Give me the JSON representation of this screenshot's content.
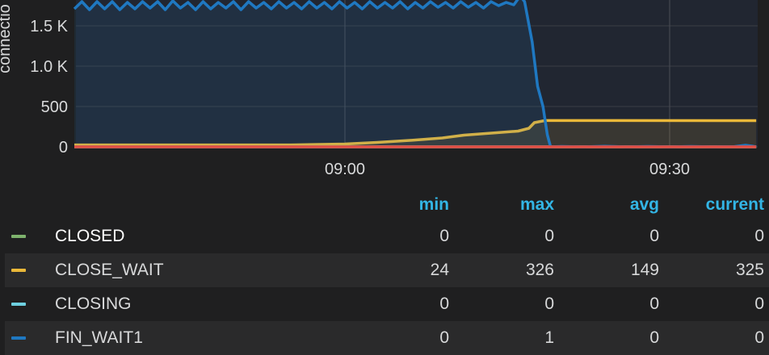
{
  "chart_data": {
    "type": "line",
    "ylabel": "connectio",
    "x_ticks": [
      "09:00",
      "09:30"
    ],
    "y_ticks": [
      "0",
      "500",
      "1.0 K",
      "1.5 K"
    ],
    "y_tick_values": [
      0,
      500,
      1000,
      1500
    ],
    "ylim": [
      0,
      1870
    ],
    "x_range_minutes": [
      -25,
      38
    ],
    "grid": true,
    "series": [
      {
        "name": "CLOSED",
        "color": "#7eb26d",
        "x": [
          -25,
          38
        ],
        "y": [
          0,
          0
        ],
        "fill": false
      },
      {
        "name": "CLOSE_WAIT",
        "color": "#eab839",
        "x": [
          -25,
          -5,
          0,
          3,
          6,
          9,
          11,
          14,
          16,
          17,
          17.5,
          18.5,
          38
        ],
        "y": [
          24,
          24,
          35,
          55,
          80,
          110,
          145,
          175,
          195,
          230,
          300,
          326,
          325
        ],
        "fill": true
      },
      {
        "name": "CLOSING",
        "color": "#6ed0e0",
        "x": [
          -25,
          38
        ],
        "y": [
          0,
          0
        ],
        "fill": false
      },
      {
        "name": "FIN_WAIT1",
        "color": "#1f78c1",
        "x": [
          -25,
          -24.3,
          -23.6,
          -22.9,
          -22.2,
          -21.5,
          -20.8,
          -20.1,
          -19.4,
          -18.7,
          -18,
          -17.3,
          -16.6,
          -15.9,
          -15.2,
          -14.5,
          -13.8,
          -13.1,
          -12.4,
          -11.7,
          -11,
          -10.3,
          -9.6,
          -8.9,
          -8.2,
          -7.5,
          -6.8,
          -6.1,
          -5.4,
          -4.7,
          -4,
          -3.3,
          -2.6,
          -1.9,
          -1.2,
          -0.5,
          0.2,
          0.9,
          1.6,
          2.3,
          3,
          3.7,
          4.4,
          5.1,
          5.8,
          6.5,
          7.2,
          7.9,
          8.6,
          9.3,
          10,
          10.7,
          11.4,
          12.1,
          12.8,
          13.5,
          14.2,
          14.9,
          15.6,
          16.2,
          16.6,
          17.3,
          17.8,
          18.3,
          18.7,
          19,
          20,
          22,
          24,
          26,
          28,
          30,
          32,
          34,
          36,
          37,
          37.6,
          38
        ],
        "y": [
          1710,
          1800,
          1700,
          1800,
          1710,
          1800,
          1700,
          1790,
          1710,
          1800,
          1720,
          1800,
          1700,
          1810,
          1720,
          1790,
          1700,
          1800,
          1710,
          1790,
          1720,
          1800,
          1700,
          1800,
          1720,
          1790,
          1710,
          1800,
          1720,
          1790,
          1710,
          1800,
          1720,
          1790,
          1710,
          1800,
          1720,
          1790,
          1710,
          1800,
          1720,
          1790,
          1720,
          1800,
          1710,
          1790,
          1720,
          1800,
          1730,
          1790,
          1720,
          1800,
          1730,
          1790,
          1720,
          1800,
          1750,
          1790,
          1760,
          1870,
          1800,
          1300,
          750,
          500,
          150,
          0,
          5,
          0,
          8,
          0,
          5,
          0,
          5,
          0,
          4,
          20,
          10,
          0
        ],
        "fill": true
      },
      {
        "name": "",
        "color": "#e24d42",
        "x": [
          -25,
          38
        ],
        "y": [
          0,
          0
        ],
        "fill": false
      }
    ]
  },
  "legend": {
    "headers": {
      "min": "min",
      "max": "max",
      "avg": "avg",
      "current": "current"
    },
    "rows": [
      {
        "name": "CLOSED",
        "color": "#7eb26d",
        "min": "0",
        "max": "0",
        "avg": "0",
        "current": "0"
      },
      {
        "name": "CLOSE_WAIT",
        "color": "#eab839",
        "min": "24",
        "max": "326",
        "avg": "149",
        "current": "325"
      },
      {
        "name": "CLOSING",
        "color": "#6ed0e0",
        "min": "0",
        "max": "0",
        "avg": "0",
        "current": "0"
      },
      {
        "name": "FIN_WAIT1",
        "color": "#1f78c1",
        "min": "0",
        "max": "1",
        "avg": "0",
        "current": "0"
      }
    ]
  }
}
